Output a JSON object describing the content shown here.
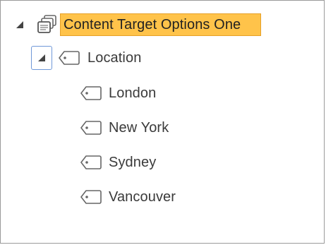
{
  "tree": {
    "root": {
      "label": "Content Target Options One",
      "icon": "stacked-documents-icon",
      "expanded": true,
      "selected": true,
      "highlight_color": "#ffc34a"
    },
    "location": {
      "label": "Location",
      "icon": "tag-icon",
      "expanded": true,
      "focused": true
    },
    "items": [
      {
        "label": "London",
        "icon": "tag-icon"
      },
      {
        "label": "New York",
        "icon": "tag-icon"
      },
      {
        "label": "Sydney",
        "icon": "tag-icon"
      },
      {
        "label": "Vancouver",
        "icon": "tag-icon"
      }
    ]
  }
}
